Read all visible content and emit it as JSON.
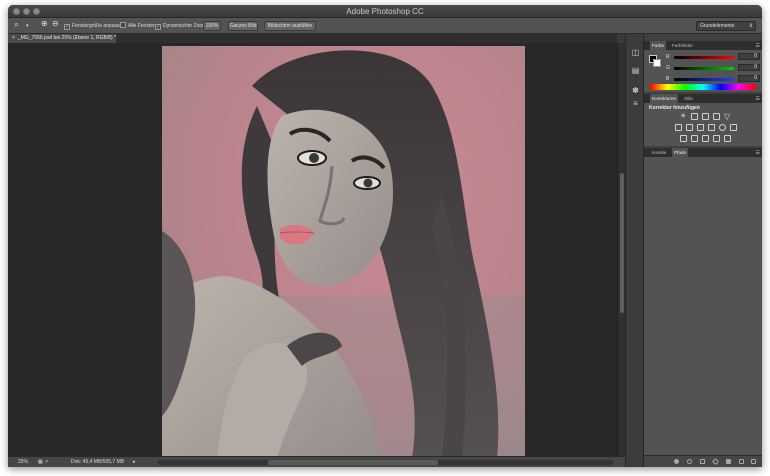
{
  "window": {
    "title": "Adobe Photoshop CC"
  },
  "options": {
    "fit_windows": "Fenstergröße anpassen",
    "all_windows": "Alle Fenster",
    "scrubby_zoom": "Dynamischer Zoom",
    "btn_100": "100%",
    "btn_fit": "Ganzes Bild",
    "btn_fill": "Bildschirm ausfüllen",
    "workspace": "Grundelemente"
  },
  "document": {
    "tab_label": "_MG_7066.psd bei 25% (Ebene 1, RGB/8) *",
    "zoom": "25%",
    "doc_info": "Dok: 45,4 MB/505,7 MB"
  },
  "panels": {
    "color": {
      "tab_farbe": "Farbe",
      "tab_farbfelder": "Farbfelder",
      "r_label": "R",
      "g_label": "G",
      "b_label": "B",
      "r": "0",
      "g": "0",
      "b": "0"
    },
    "adjustments": {
      "tab_korrekturen": "Korrekturen",
      "tab_stile": "Stile",
      "title": "Korrektur hinzufügen"
    },
    "layers": {
      "tab_kanaele": "Kanäle",
      "tab_pfade": "Pfade"
    }
  },
  "colors": {
    "accent": "#b54a59",
    "panel_bg": "#535353",
    "canvas_bg": "#282828"
  }
}
